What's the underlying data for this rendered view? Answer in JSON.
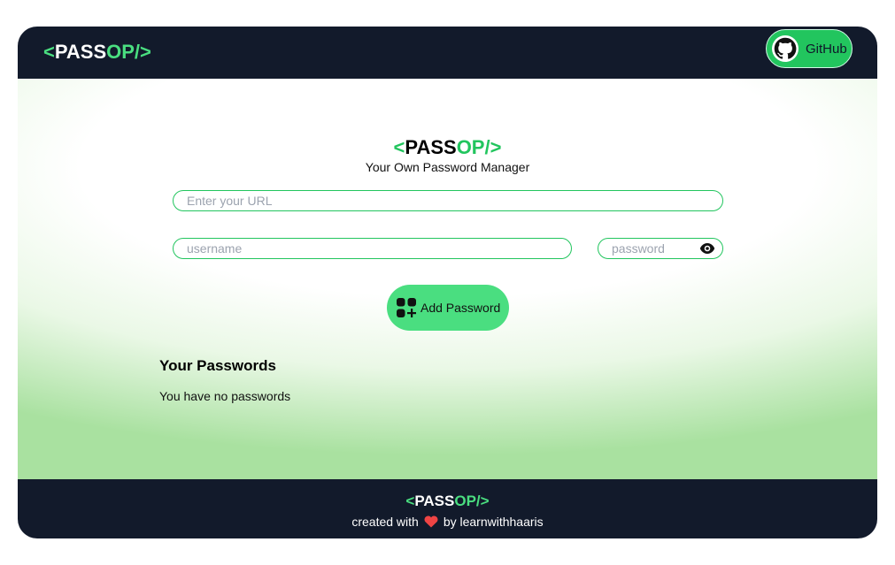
{
  "navbar": {
    "logo": {
      "open": "<",
      "pass": "PASS",
      "op": "OP/",
      "close": ">"
    },
    "github_label": "GitHub"
  },
  "hero": {
    "logo": {
      "open": "<",
      "pass": "PASS",
      "op": "OP/",
      "close": ">"
    },
    "subtitle": "Your Own Password Manager"
  },
  "form": {
    "url_placeholder": "Enter your URL",
    "url_value": "",
    "username_placeholder": "username",
    "username_value": "",
    "password_placeholder": "password",
    "password_value": "",
    "add_button_label": "Add Password"
  },
  "passwords": {
    "title": "Your Passwords",
    "empty_message": "You have no passwords"
  },
  "footer": {
    "logo": {
      "open": "<",
      "pass": "PASS",
      "op": "OP/",
      "close": ">"
    },
    "credit_prefix": "created with",
    "credit_suffix": "by learnwithhaaris"
  },
  "icons": {
    "github": "github-icon",
    "eye": "eye-icon",
    "add": "add-password-icon",
    "heart": "heart-icon"
  },
  "colors": {
    "navbar_bg": "#121a2b",
    "accent": "#22c55e",
    "button_green": "#4ade80",
    "heart": "#ef4444"
  }
}
